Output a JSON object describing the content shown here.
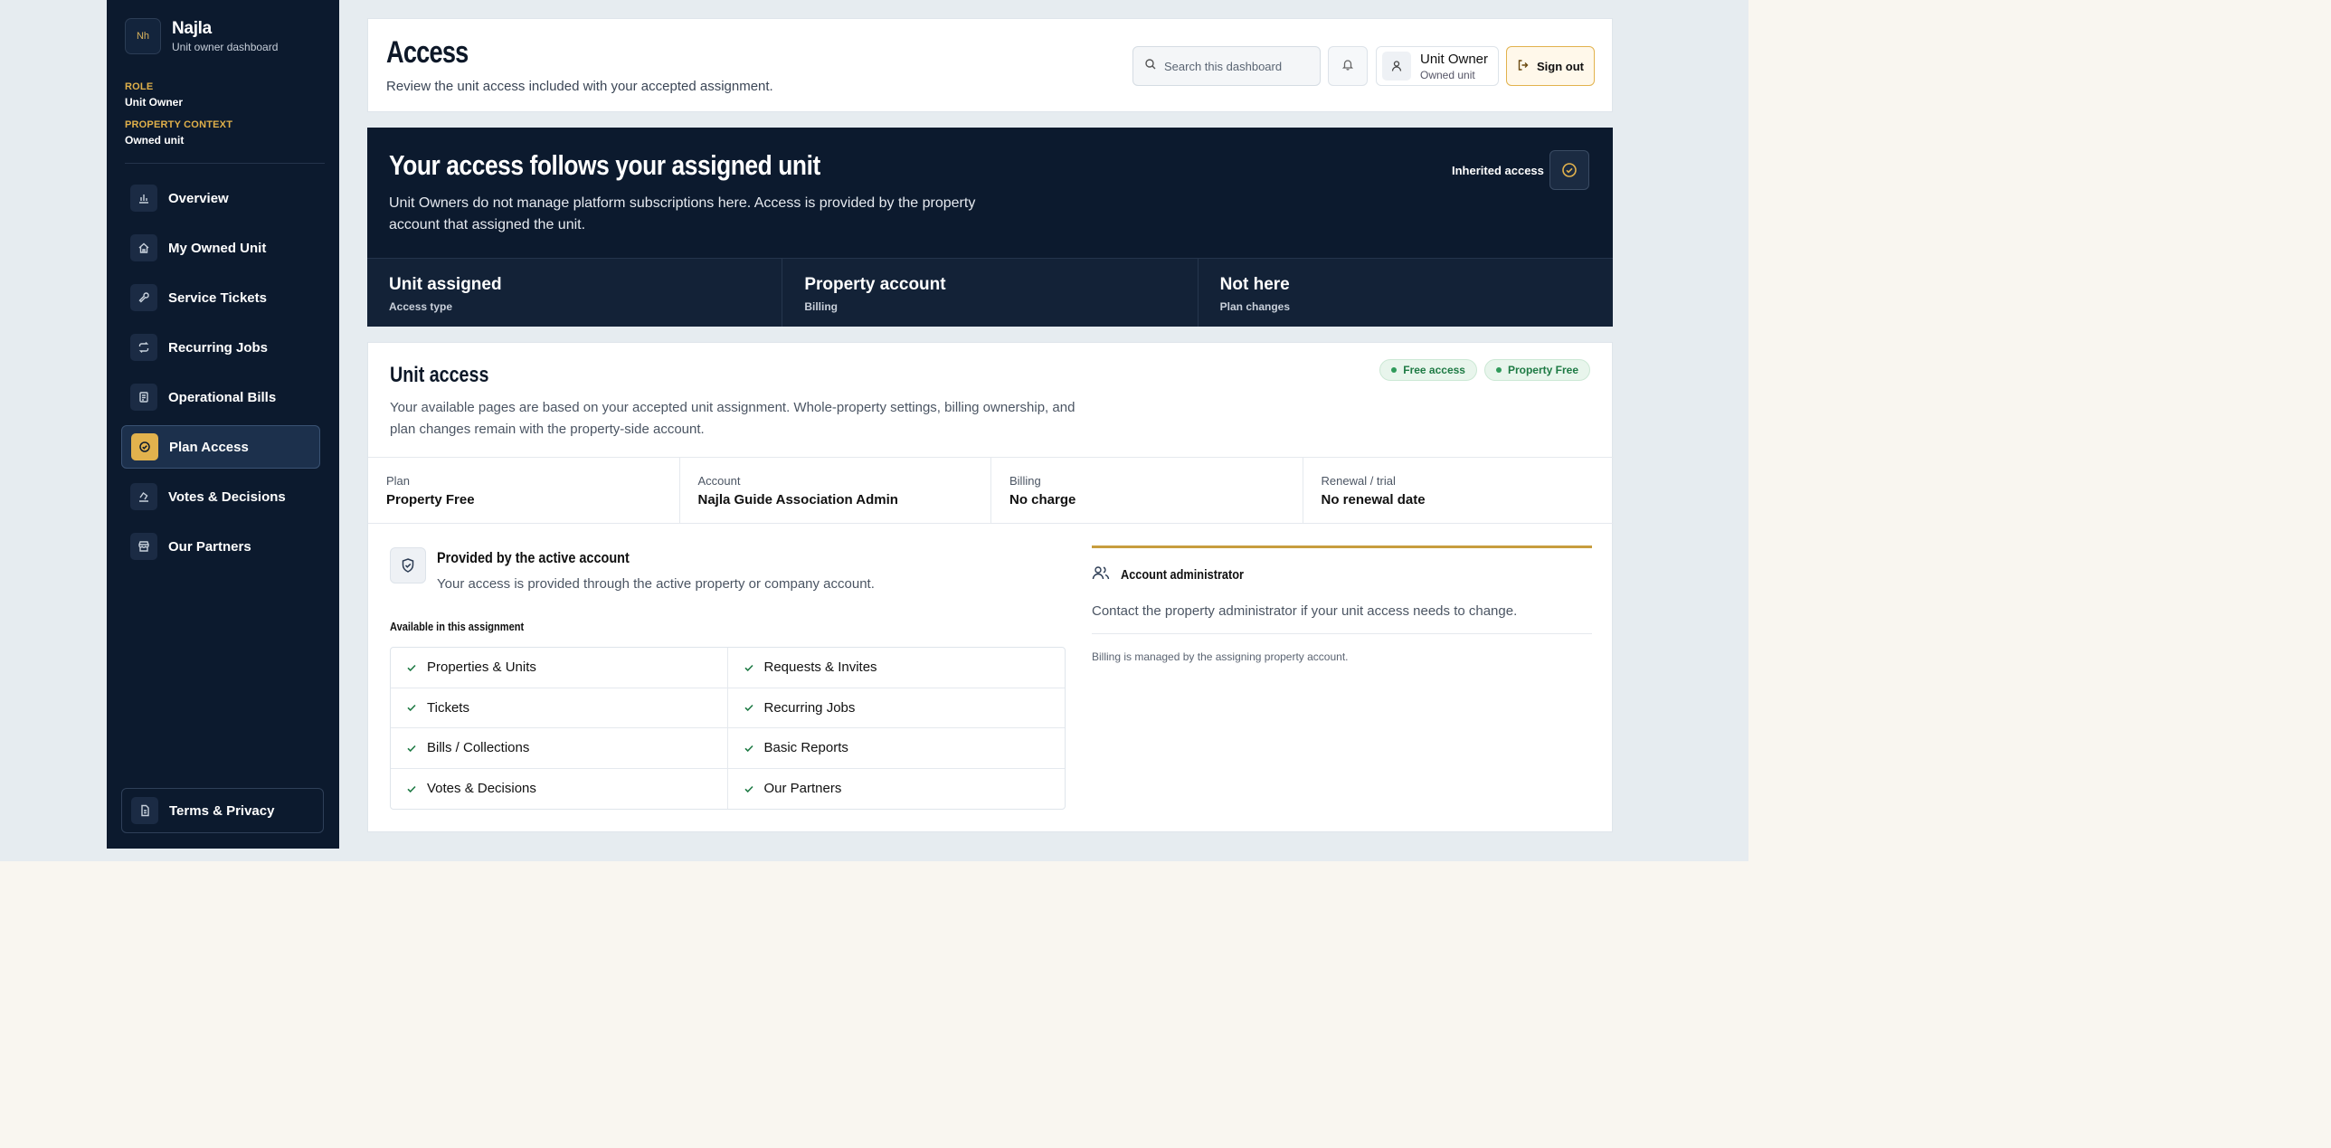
{
  "brand": {
    "logo_text": "Nh",
    "name": "Najla",
    "subtitle": "Unit owner dashboard"
  },
  "context": {
    "role_label": "ROLE",
    "role_value": "Unit Owner",
    "property_label": "PROPERTY CONTEXT",
    "property_value": "Owned unit"
  },
  "nav": {
    "items": [
      {
        "label": "Overview",
        "icon": "bar-chart-icon"
      },
      {
        "label": "My Owned Unit",
        "icon": "home-icon"
      },
      {
        "label": "Service Tickets",
        "icon": "wrench-icon"
      },
      {
        "label": "Recurring Jobs",
        "icon": "repeat-icon"
      },
      {
        "label": "Operational Bills",
        "icon": "receipt-icon"
      },
      {
        "label": "Plan Access",
        "icon": "check-circle-icon",
        "active": true
      },
      {
        "label": "Votes & Decisions",
        "icon": "ballot-icon"
      },
      {
        "label": "Our Partners",
        "icon": "store-icon"
      }
    ],
    "terms_label": "Terms & Privacy"
  },
  "header": {
    "title": "Access",
    "subtitle": "Review the unit access included with your accepted assignment.",
    "search_placeholder": "Search this dashboard",
    "user_name": "Unit Owner",
    "user_role": "Owned unit",
    "signout_label": "Sign out"
  },
  "hero": {
    "title": "Your access follows your assigned unit",
    "description": "Unit Owners do not manage platform subscriptions here. Access is provided by the property account that assigned the unit.",
    "badge_label": "Inherited access",
    "stats": [
      {
        "value": "Unit assigned",
        "label": "Access type"
      },
      {
        "value": "Property account",
        "label": "Billing"
      },
      {
        "value": "Not here",
        "label": "Plan changes"
      }
    ]
  },
  "unit_access": {
    "title": "Unit access",
    "description": "Your available pages are based on your accepted unit assignment. Whole-property settings, billing ownership, and plan changes remain with the property-side account.",
    "pills": [
      "Free access",
      "Property Free"
    ],
    "info": [
      {
        "label": "Plan",
        "value": "Property Free"
      },
      {
        "label": "Account",
        "value": "Najla Guide Association Admin"
      },
      {
        "label": "Billing",
        "value": "No charge"
      },
      {
        "label": "Renewal / trial",
        "value": "No renewal date"
      }
    ],
    "provided_title": "Provided by the active account",
    "provided_desc": "Your access is provided through the active property or company account.",
    "available_title": "Available in this assignment",
    "features": [
      "Properties & Units",
      "Requests & Invites",
      "Tickets",
      "Recurring Jobs",
      "Bills / Collections",
      "Basic Reports",
      "Votes & Decisions",
      "Our Partners"
    ],
    "admin_title": "Account administrator",
    "admin_desc": "Contact the property administrator if your unit access needs to change.",
    "admin_note": "Billing is managed by the assigning property account."
  },
  "colors": {
    "navy": "#0c1a2e",
    "accent": "#e2b24d",
    "success": "#1e7a44"
  }
}
